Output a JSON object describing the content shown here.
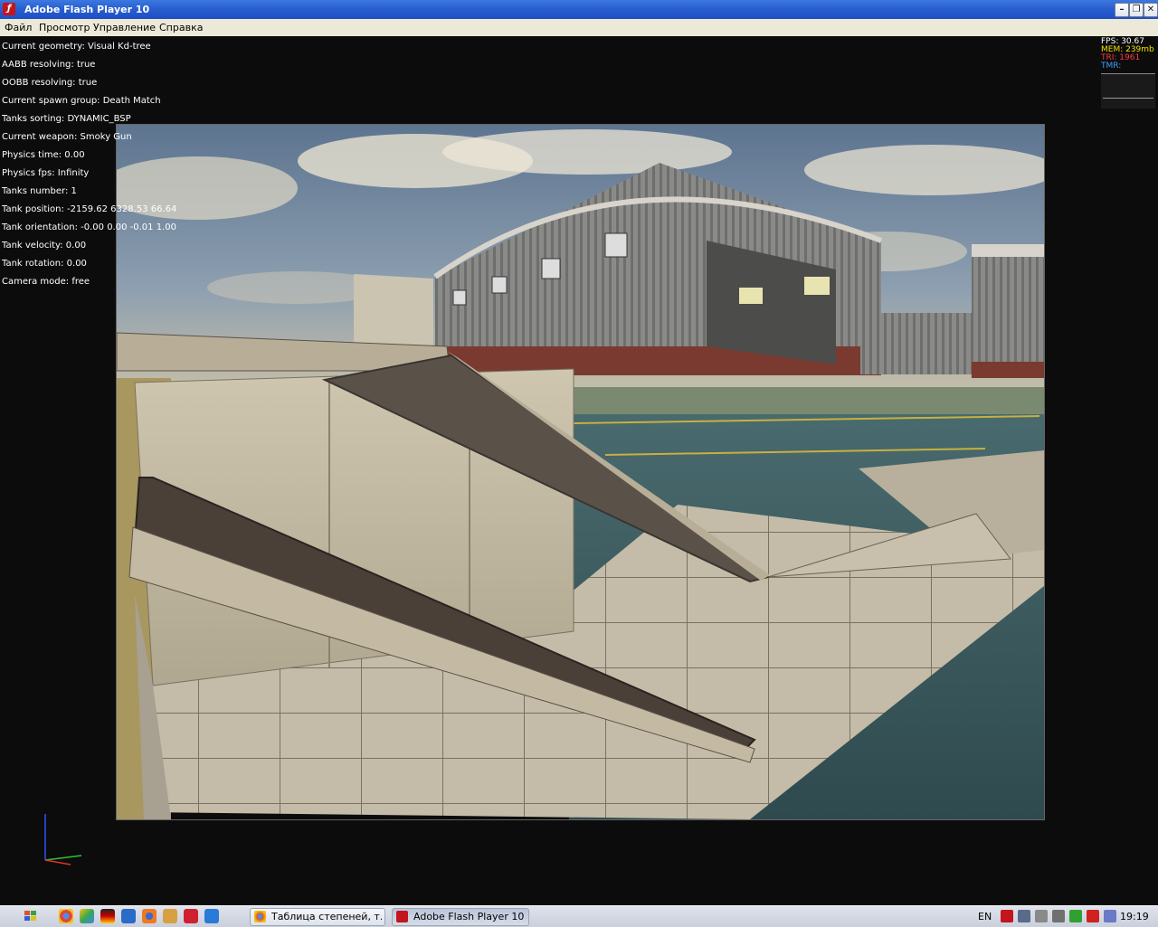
{
  "window": {
    "title": "Adobe Flash Player 10",
    "controls": [
      "minimize",
      "restore",
      "close"
    ]
  },
  "menu": {
    "items": [
      "Файл",
      "Просмотр",
      "Управление",
      "Справка"
    ]
  },
  "info_lines": [
    "Current geometry: Visual Kd-tree",
    "AABB resolving: true",
    "OOBB resolving: true",
    "Current spawn group: Death Match",
    "Tanks sorting: DYNAMIC_BSP",
    "Current weapon: Smoky Gun",
    "Physics time: 0.00",
    "Physics fps: Infinity",
    "Tanks number: 1",
    "Tank position: -2159.62 6328.53 66.64",
    "Tank orientation: -0.00 0.00 -0.01 1.00",
    "Tank velocity: 0.00",
    "Tank rotation: 0.00",
    "Camera mode: free"
  ],
  "stats": {
    "fps": "FPS: 30.67",
    "mem": "MEM: 239mb",
    "tri": "TRI: 1961",
    "tmr": "TMR:",
    "colors": {
      "fps": "#ffffff",
      "mem": "#f0e000",
      "tri": "#ff3a3a",
      "tmr": "#3aa0ff"
    }
  },
  "taskbar": {
    "tasks": [
      {
        "label": "Таблица степеней, т...",
        "active": false
      },
      {
        "label": "Adobe Flash Player 10",
        "active": true
      }
    ],
    "language": "EN",
    "clock": "19:19"
  }
}
